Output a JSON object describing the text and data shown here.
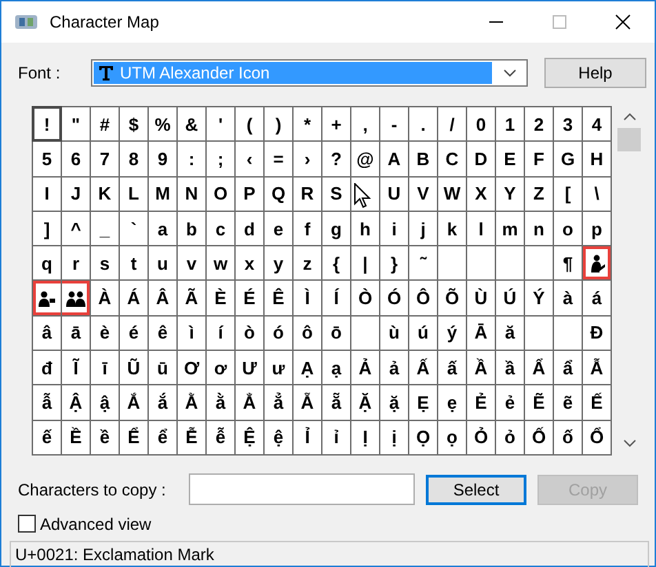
{
  "window": {
    "title": "Character Map"
  },
  "font": {
    "label": "Font :",
    "value": "UTM Alexander Icon"
  },
  "help_button": "Help",
  "grid": [
    [
      {
        "kind": "char",
        "char": "!",
        "selected": true,
        "marked": false
      },
      {
        "kind": "char",
        "char": "\"",
        "selected": false,
        "marked": false
      },
      {
        "kind": "char",
        "char": "#",
        "selected": false,
        "marked": false
      },
      {
        "kind": "char",
        "char": "$",
        "selected": false,
        "marked": false
      },
      {
        "kind": "char",
        "char": "%",
        "selected": false,
        "marked": false
      },
      {
        "kind": "char",
        "char": "&",
        "selected": false,
        "marked": false
      },
      {
        "kind": "char",
        "char": "'",
        "selected": false,
        "marked": false
      },
      {
        "kind": "char",
        "char": "(",
        "selected": false,
        "marked": false
      },
      {
        "kind": "char",
        "char": ")",
        "selected": false,
        "marked": false
      },
      {
        "kind": "char",
        "char": "*",
        "selected": false,
        "marked": false
      },
      {
        "kind": "char",
        "char": "+",
        "selected": false,
        "marked": false
      },
      {
        "kind": "char",
        "char": ",",
        "selected": false,
        "marked": false
      },
      {
        "kind": "char",
        "char": "-",
        "selected": false,
        "marked": false
      },
      {
        "kind": "char",
        "char": ".",
        "selected": false,
        "marked": false
      },
      {
        "kind": "char",
        "char": "/",
        "selected": false,
        "marked": false
      },
      {
        "kind": "char",
        "char": "0",
        "selected": false,
        "marked": false
      },
      {
        "kind": "char",
        "char": "1",
        "selected": false,
        "marked": false
      },
      {
        "kind": "char",
        "char": "2",
        "selected": false,
        "marked": false
      },
      {
        "kind": "char",
        "char": "3",
        "selected": false,
        "marked": false
      },
      {
        "kind": "char",
        "char": "4",
        "selected": false,
        "marked": false
      }
    ],
    [
      {
        "kind": "char",
        "char": "5",
        "selected": false,
        "marked": false
      },
      {
        "kind": "char",
        "char": "6",
        "selected": false,
        "marked": false
      },
      {
        "kind": "char",
        "char": "7",
        "selected": false,
        "marked": false
      },
      {
        "kind": "char",
        "char": "8",
        "selected": false,
        "marked": false
      },
      {
        "kind": "char",
        "char": "9",
        "selected": false,
        "marked": false
      },
      {
        "kind": "char",
        "char": ":",
        "selected": false,
        "marked": false
      },
      {
        "kind": "char",
        "char": ";",
        "selected": false,
        "marked": false
      },
      {
        "kind": "char",
        "char": "‹",
        "selected": false,
        "marked": false
      },
      {
        "kind": "char",
        "char": "=",
        "selected": false,
        "marked": false
      },
      {
        "kind": "char",
        "char": "›",
        "selected": false,
        "marked": false
      },
      {
        "kind": "char",
        "char": "?",
        "selected": false,
        "marked": false
      },
      {
        "kind": "char",
        "char": "@",
        "selected": false,
        "marked": false
      },
      {
        "kind": "char",
        "char": "A",
        "selected": false,
        "marked": false
      },
      {
        "kind": "char",
        "char": "B",
        "selected": false,
        "marked": false
      },
      {
        "kind": "char",
        "char": "C",
        "selected": false,
        "marked": false
      },
      {
        "kind": "char",
        "char": "D",
        "selected": false,
        "marked": false
      },
      {
        "kind": "char",
        "char": "E",
        "selected": false,
        "marked": false
      },
      {
        "kind": "char",
        "char": "F",
        "selected": false,
        "marked": false
      },
      {
        "kind": "char",
        "char": "G",
        "selected": false,
        "marked": false
      },
      {
        "kind": "char",
        "char": "H",
        "selected": false,
        "marked": false
      }
    ],
    [
      {
        "kind": "char",
        "char": "I",
        "selected": false,
        "marked": false
      },
      {
        "kind": "char",
        "char": "J",
        "selected": false,
        "marked": false
      },
      {
        "kind": "char",
        "char": "K",
        "selected": false,
        "marked": false
      },
      {
        "kind": "char",
        "char": "L",
        "selected": false,
        "marked": false
      },
      {
        "kind": "char",
        "char": "M",
        "selected": false,
        "marked": false
      },
      {
        "kind": "char",
        "char": "N",
        "selected": false,
        "marked": false
      },
      {
        "kind": "char",
        "char": "O",
        "selected": false,
        "marked": false
      },
      {
        "kind": "char",
        "char": "P",
        "selected": false,
        "marked": false
      },
      {
        "kind": "char",
        "char": "Q",
        "selected": false,
        "marked": false
      },
      {
        "kind": "char",
        "char": "R",
        "selected": false,
        "marked": false
      },
      {
        "kind": "char",
        "char": "S",
        "selected": false,
        "marked": false
      },
      {
        "kind": "pointer",
        "selected": false,
        "marked": false
      },
      {
        "kind": "char",
        "char": "U",
        "selected": false,
        "marked": false
      },
      {
        "kind": "char",
        "char": "V",
        "selected": false,
        "marked": false
      },
      {
        "kind": "char",
        "char": "W",
        "selected": false,
        "marked": false
      },
      {
        "kind": "char",
        "char": "X",
        "selected": false,
        "marked": false
      },
      {
        "kind": "char",
        "char": "Y",
        "selected": false,
        "marked": false
      },
      {
        "kind": "char",
        "char": "Z",
        "selected": false,
        "marked": false
      },
      {
        "kind": "char",
        "char": "[",
        "selected": false,
        "marked": false
      },
      {
        "kind": "char",
        "char": "\\",
        "selected": false,
        "marked": false
      }
    ],
    [
      {
        "kind": "char",
        "char": "]",
        "selected": false,
        "marked": false
      },
      {
        "kind": "char",
        "char": "^",
        "selected": false,
        "marked": false
      },
      {
        "kind": "char",
        "char": "_",
        "selected": false,
        "marked": false
      },
      {
        "kind": "char",
        "char": "`",
        "selected": false,
        "marked": false
      },
      {
        "kind": "char",
        "char": "a",
        "selected": false,
        "marked": false
      },
      {
        "kind": "char",
        "char": "b",
        "selected": false,
        "marked": false
      },
      {
        "kind": "char",
        "char": "c",
        "selected": false,
        "marked": false
      },
      {
        "kind": "char",
        "char": "d",
        "selected": false,
        "marked": false
      },
      {
        "kind": "char",
        "char": "e",
        "selected": false,
        "marked": false
      },
      {
        "kind": "char",
        "char": "f",
        "selected": false,
        "marked": false
      },
      {
        "kind": "char",
        "char": "g",
        "selected": false,
        "marked": false
      },
      {
        "kind": "char",
        "char": "h",
        "selected": false,
        "marked": false
      },
      {
        "kind": "char",
        "char": "i",
        "selected": false,
        "marked": false
      },
      {
        "kind": "char",
        "char": "j",
        "selected": false,
        "marked": false
      },
      {
        "kind": "char",
        "char": "k",
        "selected": false,
        "marked": false
      },
      {
        "kind": "char",
        "char": "l",
        "selected": false,
        "marked": false
      },
      {
        "kind": "char",
        "char": "m",
        "selected": false,
        "marked": false
      },
      {
        "kind": "char",
        "char": "n",
        "selected": false,
        "marked": false
      },
      {
        "kind": "char",
        "char": "o",
        "selected": false,
        "marked": false
      },
      {
        "kind": "char",
        "char": "p",
        "selected": false,
        "marked": false
      }
    ],
    [
      {
        "kind": "char",
        "char": "q",
        "selected": false,
        "marked": false
      },
      {
        "kind": "char",
        "char": "r",
        "selected": false,
        "marked": false
      },
      {
        "kind": "char",
        "char": "s",
        "selected": false,
        "marked": false
      },
      {
        "kind": "char",
        "char": "t",
        "selected": false,
        "marked": false
      },
      {
        "kind": "char",
        "char": "u",
        "selected": false,
        "marked": false
      },
      {
        "kind": "char",
        "char": "v",
        "selected": false,
        "marked": false
      },
      {
        "kind": "char",
        "char": "w",
        "selected": false,
        "marked": false
      },
      {
        "kind": "char",
        "char": "x",
        "selected": false,
        "marked": false
      },
      {
        "kind": "char",
        "char": "y",
        "selected": false,
        "marked": false
      },
      {
        "kind": "char",
        "char": "z",
        "selected": false,
        "marked": false
      },
      {
        "kind": "char",
        "char": "{",
        "selected": false,
        "marked": false
      },
      {
        "kind": "char",
        "char": "|",
        "selected": false,
        "marked": false
      },
      {
        "kind": "char",
        "char": "}",
        "selected": false,
        "marked": false
      },
      {
        "kind": "char",
        "char": "˜",
        "selected": false,
        "marked": false
      },
      {
        "kind": "blank",
        "selected": false,
        "marked": false
      },
      {
        "kind": "blank",
        "selected": false,
        "marked": false
      },
      {
        "kind": "blank",
        "selected": false,
        "marked": false
      },
      {
        "kind": "blank",
        "selected": false,
        "marked": false
      },
      {
        "kind": "char",
        "char": "¶",
        "selected": false,
        "marked": false
      },
      {
        "kind": "reader",
        "selected": false,
        "marked": true
      }
    ],
    [
      {
        "kind": "person",
        "selected": false,
        "marked": true
      },
      {
        "kind": "people",
        "selected": false,
        "marked": true
      },
      {
        "kind": "char",
        "char": "À",
        "selected": false,
        "marked": false
      },
      {
        "kind": "char",
        "char": "Á",
        "selected": false,
        "marked": false
      },
      {
        "kind": "char",
        "char": "Â",
        "selected": false,
        "marked": false
      },
      {
        "kind": "char",
        "char": "Ã",
        "selected": false,
        "marked": false
      },
      {
        "kind": "char",
        "char": "È",
        "selected": false,
        "marked": false
      },
      {
        "kind": "char",
        "char": "É",
        "selected": false,
        "marked": false
      },
      {
        "kind": "char",
        "char": "Ê",
        "selected": false,
        "marked": false
      },
      {
        "kind": "char",
        "char": "Ì",
        "selected": false,
        "marked": false
      },
      {
        "kind": "char",
        "char": "Í",
        "selected": false,
        "marked": false
      },
      {
        "kind": "char",
        "char": "Ò",
        "selected": false,
        "marked": false
      },
      {
        "kind": "char",
        "char": "Ó",
        "selected": false,
        "marked": false
      },
      {
        "kind": "char",
        "char": "Ô",
        "selected": false,
        "marked": false
      },
      {
        "kind": "char",
        "char": "Õ",
        "selected": false,
        "marked": false
      },
      {
        "kind": "char",
        "char": "Ù",
        "selected": false,
        "marked": false
      },
      {
        "kind": "char",
        "char": "Ú",
        "selected": false,
        "marked": false
      },
      {
        "kind": "char",
        "char": "Ý",
        "selected": false,
        "marked": false
      },
      {
        "kind": "char",
        "char": "à",
        "selected": false,
        "marked": false
      },
      {
        "kind": "char",
        "char": "á",
        "selected": false,
        "marked": false
      }
    ],
    [
      {
        "kind": "char",
        "char": "â",
        "selected": false,
        "marked": false
      },
      {
        "kind": "char",
        "char": "ā",
        "selected": false,
        "marked": false
      },
      {
        "kind": "char",
        "char": "è",
        "selected": false,
        "marked": false
      },
      {
        "kind": "char",
        "char": "é",
        "selected": false,
        "marked": false
      },
      {
        "kind": "char",
        "char": "ê",
        "selected": false,
        "marked": false
      },
      {
        "kind": "char",
        "char": "ì",
        "selected": false,
        "marked": false
      },
      {
        "kind": "char",
        "char": "í",
        "selected": false,
        "marked": false
      },
      {
        "kind": "char",
        "char": "ò",
        "selected": false,
        "marked": false
      },
      {
        "kind": "char",
        "char": "ó",
        "selected": false,
        "marked": false
      },
      {
        "kind": "char",
        "char": "ô",
        "selected": false,
        "marked": false
      },
      {
        "kind": "char",
        "char": "ō",
        "selected": false,
        "marked": false
      },
      {
        "kind": "blank",
        "selected": false,
        "marked": false
      },
      {
        "kind": "char",
        "char": "ù",
        "selected": false,
        "marked": false
      },
      {
        "kind": "char",
        "char": "ú",
        "selected": false,
        "marked": false
      },
      {
        "kind": "char",
        "char": "ý",
        "selected": false,
        "marked": false
      },
      {
        "kind": "char",
        "char": "Ā",
        "selected": false,
        "marked": false
      },
      {
        "kind": "char",
        "char": "ă",
        "selected": false,
        "marked": false
      },
      {
        "kind": "blank",
        "selected": false,
        "marked": false
      },
      {
        "kind": "blank",
        "selected": false,
        "marked": false
      },
      {
        "kind": "char",
        "char": "Đ",
        "selected": false,
        "marked": false
      }
    ],
    [
      {
        "kind": "char",
        "char": "đ",
        "selected": false,
        "marked": false
      },
      {
        "kind": "char",
        "char": "Ĩ",
        "selected": false,
        "marked": false
      },
      {
        "kind": "char",
        "char": "ī",
        "selected": false,
        "marked": false
      },
      {
        "kind": "char",
        "char": "Ũ",
        "selected": false,
        "marked": false
      },
      {
        "kind": "char",
        "char": "ū",
        "selected": false,
        "marked": false
      },
      {
        "kind": "char",
        "char": "Ơ",
        "selected": false,
        "marked": false
      },
      {
        "kind": "char",
        "char": "ơ",
        "selected": false,
        "marked": false
      },
      {
        "kind": "char",
        "char": "Ư",
        "selected": false,
        "marked": false
      },
      {
        "kind": "char",
        "char": "ư",
        "selected": false,
        "marked": false
      },
      {
        "kind": "char",
        "char": "Ạ",
        "selected": false,
        "marked": false
      },
      {
        "kind": "char",
        "char": "ạ",
        "selected": false,
        "marked": false
      },
      {
        "kind": "char",
        "char": "Ả",
        "selected": false,
        "marked": false
      },
      {
        "kind": "char",
        "char": "ả",
        "selected": false,
        "marked": false
      },
      {
        "kind": "char",
        "char": "Ấ",
        "selected": false,
        "marked": false
      },
      {
        "kind": "char",
        "char": "ấ",
        "selected": false,
        "marked": false
      },
      {
        "kind": "char",
        "char": "Ầ",
        "selected": false,
        "marked": false
      },
      {
        "kind": "char",
        "char": "ầ",
        "selected": false,
        "marked": false
      },
      {
        "kind": "char",
        "char": "Ẩ",
        "selected": false,
        "marked": false
      },
      {
        "kind": "char",
        "char": "ẩ",
        "selected": false,
        "marked": false
      },
      {
        "kind": "char",
        "char": "Ẫ",
        "selected": false,
        "marked": false
      }
    ],
    [
      {
        "kind": "char",
        "char": "ẫ",
        "selected": false,
        "marked": false
      },
      {
        "kind": "char",
        "char": "Ậ",
        "selected": false,
        "marked": false
      },
      {
        "kind": "char",
        "char": "ậ",
        "selected": false,
        "marked": false
      },
      {
        "kind": "char",
        "char": "Ắ",
        "selected": false,
        "marked": false
      },
      {
        "kind": "char",
        "char": "ắ",
        "selected": false,
        "marked": false
      },
      {
        "kind": "char",
        "char": "Ằ",
        "selected": false,
        "marked": false
      },
      {
        "kind": "char",
        "char": "ằ",
        "selected": false,
        "marked": false
      },
      {
        "kind": "char",
        "char": "Ẳ",
        "selected": false,
        "marked": false
      },
      {
        "kind": "char",
        "char": "ẳ",
        "selected": false,
        "marked": false
      },
      {
        "kind": "char",
        "char": "Ẵ",
        "selected": false,
        "marked": false
      },
      {
        "kind": "char",
        "char": "ẵ",
        "selected": false,
        "marked": false
      },
      {
        "kind": "char",
        "char": "Ặ",
        "selected": false,
        "marked": false
      },
      {
        "kind": "char",
        "char": "ặ",
        "selected": false,
        "marked": false
      },
      {
        "kind": "char",
        "char": "Ẹ",
        "selected": false,
        "marked": false
      },
      {
        "kind": "char",
        "char": "ẹ",
        "selected": false,
        "marked": false
      },
      {
        "kind": "char",
        "char": "Ẻ",
        "selected": false,
        "marked": false
      },
      {
        "kind": "char",
        "char": "ẻ",
        "selected": false,
        "marked": false
      },
      {
        "kind": "char",
        "char": "Ẽ",
        "selected": false,
        "marked": false
      },
      {
        "kind": "char",
        "char": "ẽ",
        "selected": false,
        "marked": false
      },
      {
        "kind": "char",
        "char": "Ế",
        "selected": false,
        "marked": false
      }
    ],
    [
      {
        "kind": "char",
        "char": "ế",
        "selected": false,
        "marked": false
      },
      {
        "kind": "char",
        "char": "Ề",
        "selected": false,
        "marked": false
      },
      {
        "kind": "char",
        "char": "ề",
        "selected": false,
        "marked": false
      },
      {
        "kind": "char",
        "char": "Ể",
        "selected": false,
        "marked": false
      },
      {
        "kind": "char",
        "char": "ể",
        "selected": false,
        "marked": false
      },
      {
        "kind": "char",
        "char": "Ễ",
        "selected": false,
        "marked": false
      },
      {
        "kind": "char",
        "char": "ễ",
        "selected": false,
        "marked": false
      },
      {
        "kind": "char",
        "char": "Ệ",
        "selected": false,
        "marked": false
      },
      {
        "kind": "char",
        "char": "ệ",
        "selected": false,
        "marked": false
      },
      {
        "kind": "char",
        "char": "Ỉ",
        "selected": false,
        "marked": false
      },
      {
        "kind": "char",
        "char": "ỉ",
        "selected": false,
        "marked": false
      },
      {
        "kind": "char",
        "char": "Ị",
        "selected": false,
        "marked": false
      },
      {
        "kind": "char",
        "char": "ị",
        "selected": false,
        "marked": false
      },
      {
        "kind": "char",
        "char": "Ọ",
        "selected": false,
        "marked": false
      },
      {
        "kind": "char",
        "char": "ọ",
        "selected": false,
        "marked": false
      },
      {
        "kind": "char",
        "char": "Ỏ",
        "selected": false,
        "marked": false
      },
      {
        "kind": "char",
        "char": "ỏ",
        "selected": false,
        "marked": false
      },
      {
        "kind": "char",
        "char": "Ố",
        "selected": false,
        "marked": false
      },
      {
        "kind": "char",
        "char": "ố",
        "selected": false,
        "marked": false
      },
      {
        "kind": "char",
        "char": "Ổ",
        "selected": false,
        "marked": false
      }
    ]
  ],
  "copy": {
    "label": "Characters to copy :",
    "select_button": "Select",
    "copy_button": "Copy",
    "copy_disabled": true
  },
  "advanced_view": {
    "label": "Advanced view",
    "checked": false
  },
  "status_bar": "U+0021: Exclamation Mark"
}
